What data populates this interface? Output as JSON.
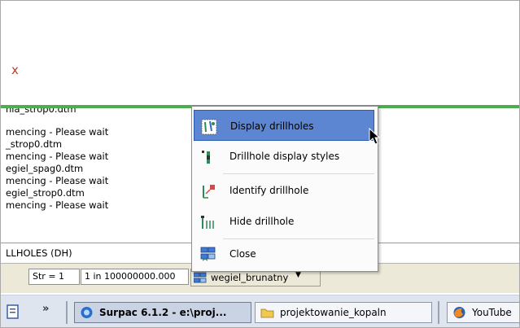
{
  "canvas": {
    "marker": "x"
  },
  "log": {
    "lines": [
      "nia_strop0.dtm",
      "mencing - Please wait",
      "_strop0.dtm",
      "mencing - Please wait",
      "egiel_spag0.dtm",
      "mencing - Please wait",
      "egiel_strop0.dtm",
      "mencing - Please wait"
    ]
  },
  "command": {
    "text": "LLHOLES (DH)"
  },
  "status": {
    "string_field": "Str = 1",
    "scale_field": "1 in 100000000.000",
    "layer_name": "wegiel_brunatny"
  },
  "menu": {
    "items": [
      {
        "label": "Display drillholes",
        "icon": "display-drillholes-icon",
        "highlighted": true
      },
      {
        "label": "Drillhole display styles",
        "icon": "drillhole-styles-icon",
        "highlighted": false
      },
      {
        "label": "Identify drillhole",
        "icon": "identify-drillhole-icon",
        "highlighted": false
      },
      {
        "label": "Hide drillhole",
        "icon": "hide-drillhole-icon",
        "highlighted": false
      },
      {
        "label": "Close",
        "icon": "close-layers-icon",
        "highlighted": false
      }
    ]
  },
  "taskbar": {
    "overflow": "»",
    "items": [
      {
        "label": "Surpac 6.1.2 - e:\\proj...",
        "icon": "surpac-icon",
        "active": true
      },
      {
        "label": "projektowanie_kopaln",
        "icon": "folder-icon",
        "active": false
      },
      {
        "label": "YouTube",
        "icon": "firefox-icon",
        "active": false
      }
    ]
  },
  "colors": {
    "highlight": "#5c86d2",
    "green_bar": "#4cae4c",
    "marker_red": "#c0392b"
  }
}
